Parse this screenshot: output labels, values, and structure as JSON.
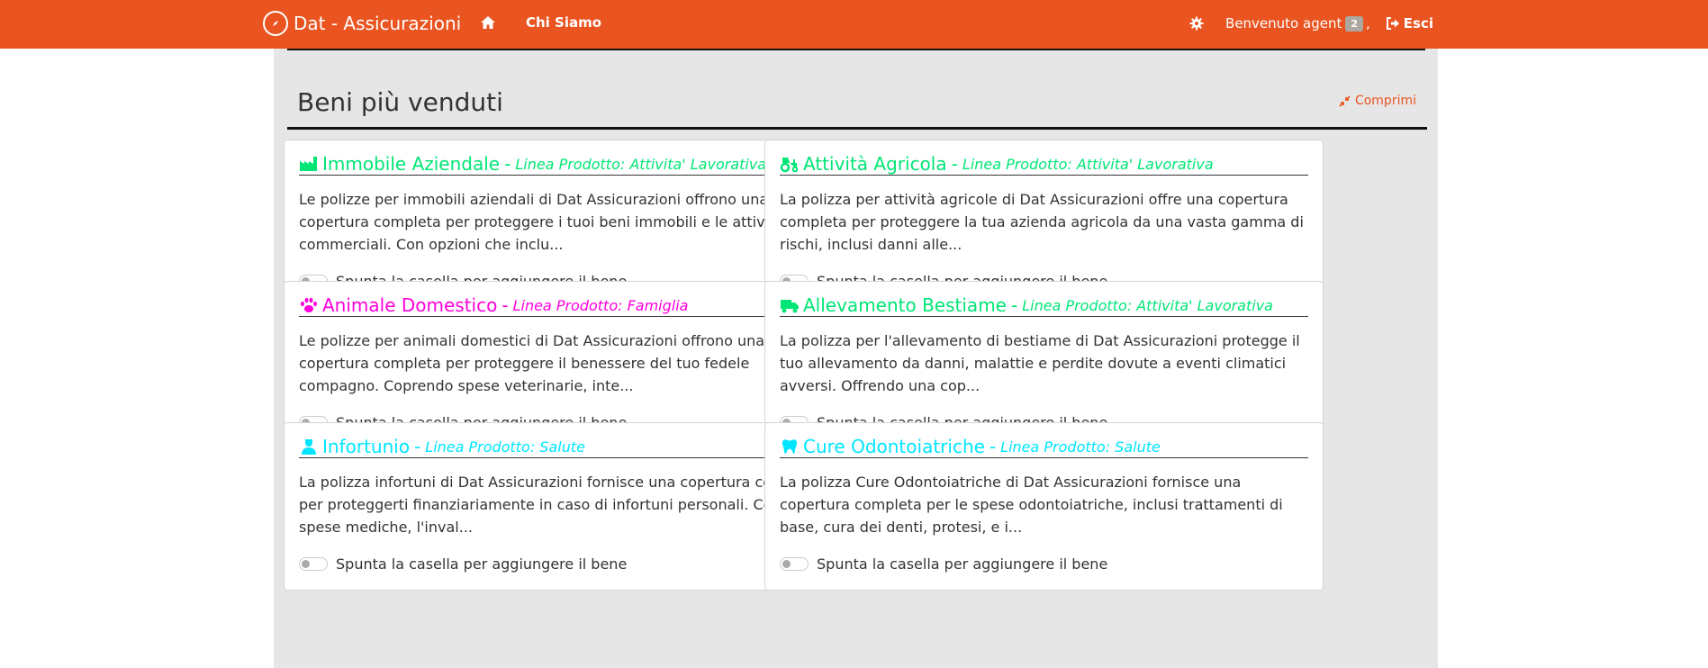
{
  "navbar": {
    "brand": "Dat - Assicurazioni",
    "chi_siamo": "Chi Siamo",
    "welcome": "Benvenuto agent",
    "badge": "2",
    "comma": ",",
    "logout": "Esci"
  },
  "section": {
    "title": "Beni più venduti",
    "collapse": "Comprimi"
  },
  "toggle_label": "Spunta la casella per aggiungere il bene",
  "cards": [
    {
      "title": "Immobile Aziendale",
      "sep": "-",
      "line": "Linea Prodotto: Attivita' Lavorativa",
      "color": "#00e676",
      "icon": "industry-icon",
      "desc": "Le polizze per immobili aziendali di Dat Assicurazioni offrono una copertura completa per proteggere i tuoi beni immobili e le attività commerciali. Con opzioni che inclu..."
    },
    {
      "title": "Attività Agricola",
      "sep": "-",
      "line": "Linea Prodotto: Attivita' Lavorativa",
      "color": "#00e676",
      "icon": "tractor-icon",
      "desc": "La polizza per attività agricole di Dat Assicurazioni offre una copertura completa per proteggere la tua azienda agricola da una vasta gamma di rischi, inclusi danni alle..."
    },
    {
      "title": "Animale Domestico",
      "sep": "-",
      "line": "Linea Prodotto: Famiglia",
      "color": "#ff00dd",
      "icon": "paw-icon",
      "desc": "Le polizze per animali domestici di Dat Assicurazioni offrono una copertura completa per proteggere il benessere del tuo fedele compagno. Coprendo spese veterinarie, inte..."
    },
    {
      "title": "Allevamento Bestiame",
      "sep": "-",
      "line": "Linea Prodotto: Attivita' Lavorativa",
      "color": "#00e676",
      "icon": "truck-icon",
      "desc": "La polizza per l'allevamento di bestiame di Dat Assicurazioni protegge il tuo allevamento da danni, malattie e perdite dovute a eventi climatici avversi. Offrendo una cop..."
    },
    {
      "title": "Infortunio",
      "sep": "-",
      "line": "Linea Prodotto: Salute",
      "color": "#00e5ff",
      "icon": "injured-person-icon",
      "desc": "La polizza infortuni di Dat Assicurazioni fornisce una copertura completa per proteggerti finanziariamente in caso di infortuni personali. Copre le spese mediche, l'inval..."
    },
    {
      "title": "Cure Odontoiatriche",
      "sep": "-",
      "line": "Linea Prodotto: Salute",
      "color": "#00e5ff",
      "icon": "tooth-icon",
      "desc": "La polizza Cure Odontoiatriche di Dat Assicurazioni fornisce una copertura completa per le spese odontoiatriche, inclusi trattamenti di base, cura dei denti, protesi, e i..."
    }
  ]
}
